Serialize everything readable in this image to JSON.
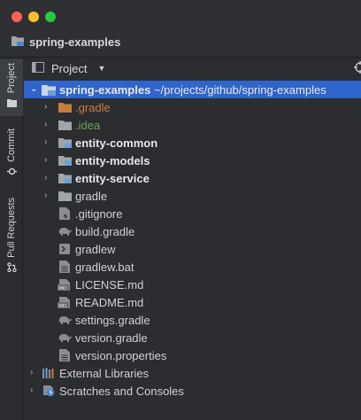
{
  "window": {
    "project_title": "spring-examples"
  },
  "sidebar": {
    "tabs": [
      {
        "label": "Project",
        "icon": "folder-icon"
      },
      {
        "label": "Commit",
        "icon": "commit-icon"
      },
      {
        "label": "Pull Requests",
        "icon": "pull-request-icon"
      }
    ]
  },
  "panel": {
    "title": "Project",
    "locate_icon": "target-icon"
  },
  "tree": {
    "root": {
      "name": "spring-examples",
      "path": "~/projects/github/spring-examples"
    },
    "items": [
      {
        "name": ".gradle"
      },
      {
        "name": ".idea"
      },
      {
        "name": "entity-common"
      },
      {
        "name": "entity-models"
      },
      {
        "name": "entity-service"
      },
      {
        "name": "gradle"
      },
      {
        "name": ".gitignore"
      },
      {
        "name": "build.gradle"
      },
      {
        "name": "gradlew"
      },
      {
        "name": "gradlew.bat"
      },
      {
        "name": "LICENSE.md"
      },
      {
        "name": "README.md"
      },
      {
        "name": "settings.gradle"
      },
      {
        "name": "version.gradle"
      },
      {
        "name": "version.properties"
      }
    ],
    "external_libraries": "External Libraries",
    "scratches": "Scratches and Consoles"
  },
  "colors": {
    "selection": "#2f65ca",
    "folder": "#a0a4ab",
    "module_folder": "#6e9fd6",
    "excluded_folder": "#c77d3e",
    "idea_folder": "#6fa35a"
  }
}
